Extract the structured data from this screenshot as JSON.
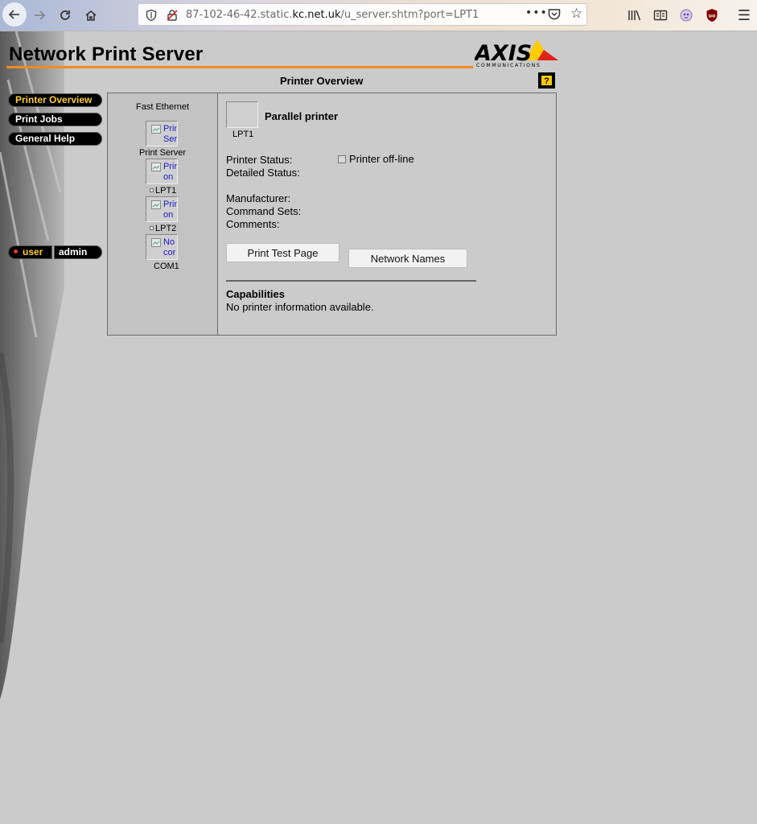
{
  "browser": {
    "url_prefix": "87-102-46-42.static.",
    "url_domain": "kc.net.uk",
    "url_path": "/u_server.shtm?port=LPT1",
    "page_actions": "•••"
  },
  "header": {
    "title": "Network Print Server",
    "logo_text": "AXIS",
    "logo_subtext": "COMMUNICATIONS",
    "accent_color": "#f28c1c"
  },
  "nav": {
    "items": [
      {
        "label": "Printer Overview"
      },
      {
        "label": "Print Jobs"
      },
      {
        "label": "General Help"
      }
    ],
    "user_label": "user",
    "admin_label": "admin"
  },
  "overview": {
    "title": "Printer Overview",
    "help_symbol": "?"
  },
  "devices": {
    "network_label": "Fast Ethernet",
    "items": [
      {
        "text1": "Prin",
        "text2": "Ser",
        "label": "Print Server"
      },
      {
        "text1": "Prin",
        "text2": "on",
        "label": "LPT1"
      },
      {
        "text1": "Prin",
        "text2": "on",
        "label": "LPT2"
      },
      {
        "text1": "No",
        "text2": "cor",
        "label": "COM1"
      }
    ]
  },
  "printer": {
    "port": "LPT1",
    "type": "Parallel printer",
    "status_label": "Printer Status:",
    "offline_label": "Printer off-line",
    "detailed_status_label": "Detailed Status:",
    "manufacturer_label": "Manufacturer:",
    "command_sets_label": "Command Sets:",
    "comments_label": "Comments:",
    "print_test_button": "Print Test Page",
    "network_names_button": "Network Names",
    "capabilities_title": "Capabilities",
    "capabilities_text": "No printer information available."
  }
}
